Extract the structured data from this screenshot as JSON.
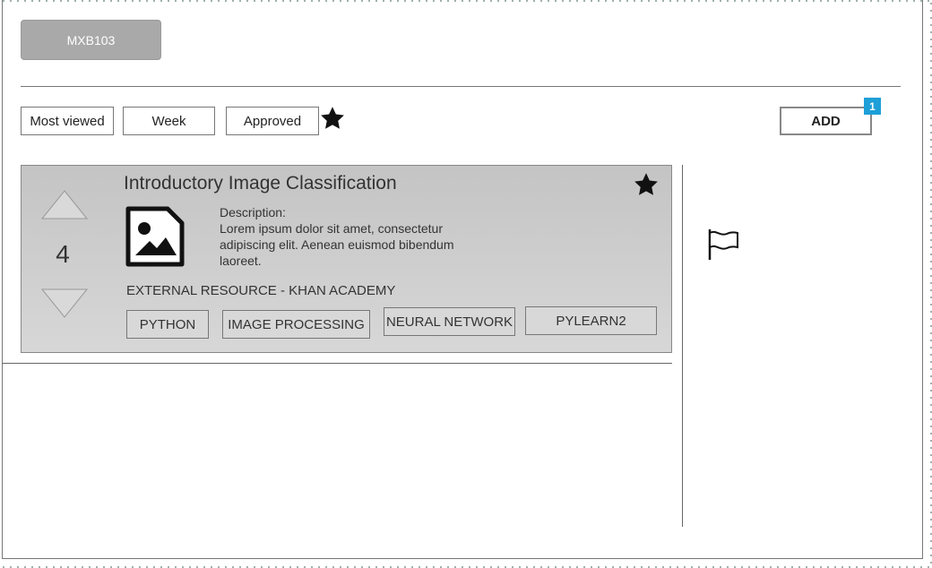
{
  "header": {
    "course_label": "MXB103"
  },
  "filters": {
    "items": [
      {
        "label": "Most viewed"
      },
      {
        "label": "Week"
      },
      {
        "label": "Approved"
      }
    ],
    "star_icon": "star-icon"
  },
  "toolbar": {
    "add_label": "ADD",
    "add_badge": "1",
    "badge_color": "#1e9fd8"
  },
  "resource_card": {
    "votes": "4",
    "title": "Introductory Image Classification",
    "description_label": "Description:",
    "description_text": "Lorem ipsum dolor sit amet, consectetur adipiscing elit. Aenean euismod bibendum laoreet.",
    "source": "EXTERNAL RESOURCE - KHAN ACADEMY",
    "tags": [
      "PYTHON",
      "IMAGE PROCESSING",
      "NEURAL NETWORK",
      "PYLEARN2"
    ],
    "thumbnail_icon": "image-icon",
    "favorite_icon": "star-icon"
  },
  "sidebar": {
    "flag_icon": "flag-icon"
  }
}
